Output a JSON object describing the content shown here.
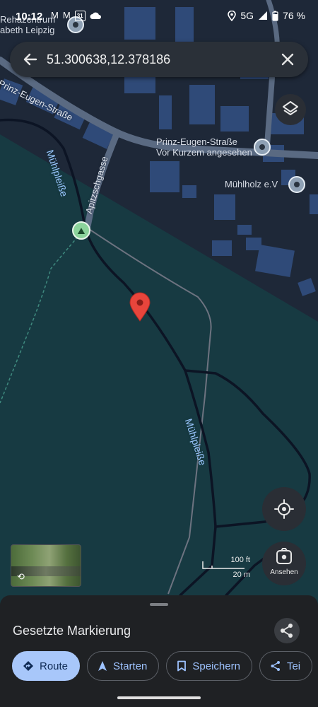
{
  "status_bar": {
    "time": "10:12",
    "network": "5G",
    "battery": "76 %",
    "calendar_day": "31"
  },
  "search": {
    "query": "51.300638,12.378186"
  },
  "map": {
    "places": [
      {
        "name": "Rehazentrum Elisabeth Leipzig",
        "line1": "Rehazentrum",
        "line2": "abeth Leipzig"
      },
      {
        "name": "Prinz-Eugen-Straße",
        "subtitle": "Vor Kurzem angesehen"
      },
      {
        "name": "Mühlholz e.V"
      }
    ],
    "streets": {
      "prinz_eugen": "Prinz-Eugen-Straße",
      "apitzschgasse": "Apitzschgasse"
    },
    "waterways": {
      "upper": "Mühlpleiße",
      "lower": "Mühlpleiße"
    },
    "scale": {
      "imperial": "100 ft",
      "metric": "20 m"
    },
    "view_button_label": "Ansehen"
  },
  "sheet": {
    "title": "Gesetzte Markierung",
    "chips": {
      "route": "Route",
      "start": "Starten",
      "save": "Speichern",
      "share": "Tei"
    }
  },
  "colors": {
    "map_background": "#1e2838",
    "building": "#2f4a78",
    "park": "#173a42",
    "waterway_line": "#0c1424",
    "marker": "#e8453c",
    "primary_chip": "#a8c7fa"
  },
  "icons": [
    "back-arrow-icon",
    "close-icon",
    "layers-icon",
    "my-location-icon",
    "camera-view-icon",
    "share-icon",
    "route-icon",
    "navigation-icon",
    "bookmark-icon",
    "red-pin-icon",
    "place-pin-icon",
    "hiking-icon"
  ]
}
